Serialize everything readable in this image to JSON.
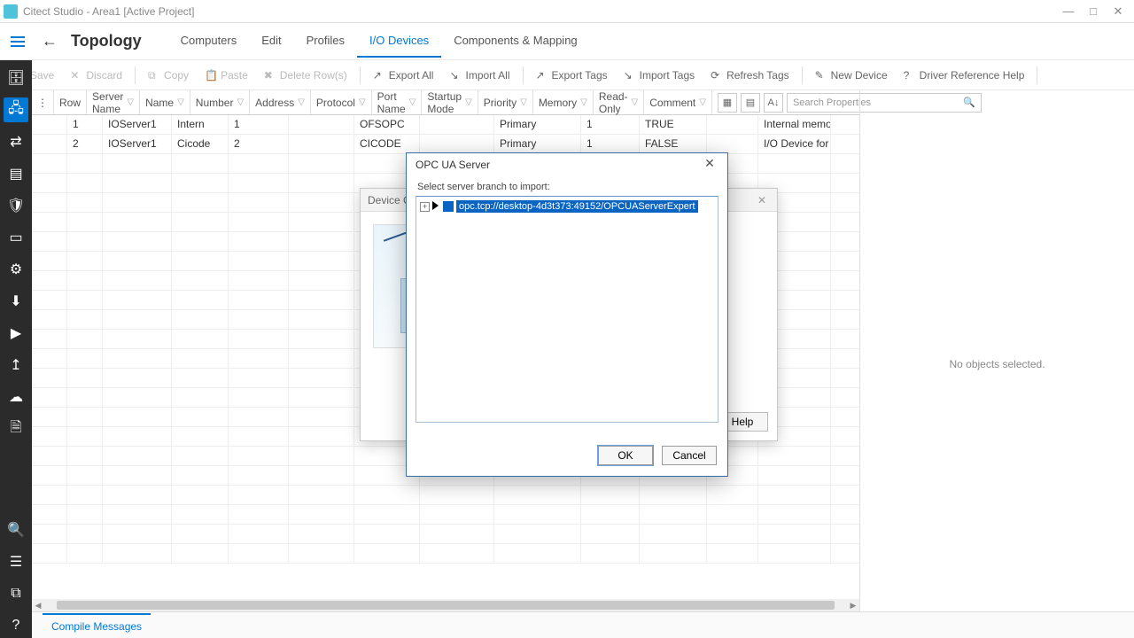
{
  "window": {
    "title": "Citect Studio - Area1 [Active Project]"
  },
  "section": "Topology",
  "tabs": [
    "Computers",
    "Edit",
    "Profiles",
    "I/O Devices",
    "Components & Mapping"
  ],
  "active_tab": "I/O Devices",
  "toolbar": {
    "save": "Save",
    "discard": "Discard",
    "copy": "Copy",
    "paste": "Paste",
    "deleterows": "Delete Row(s)",
    "exportall": "Export All",
    "importall": "Import All",
    "exporttags": "Export Tags",
    "importtags": "Import Tags",
    "refreshtags": "Refresh Tags",
    "newdevice": "New Device",
    "driverref": "Driver Reference Help"
  },
  "columns": [
    "Row",
    "Server Name",
    "Name",
    "Number",
    "Address",
    "Protocol",
    "Port Name",
    "Startup Mode",
    "Priority",
    "Memory",
    "Read-Only",
    "Comment"
  ],
  "rows": [
    {
      "row": "1",
      "server": "IOServer1",
      "name": "Intern",
      "num": "1",
      "addr": "",
      "proto": "OFSOPC",
      "port": "",
      "start": "Primary",
      "pri": "1",
      "mem": "TRUE",
      "ro": "",
      "comment": "Internal memory c"
    },
    {
      "row": "2",
      "server": "IOServer1",
      "name": "Cicode",
      "num": "2",
      "addr": "",
      "proto": "CICODE",
      "port": "",
      "start": "Primary",
      "pri": "1",
      "mem": "FALSE",
      "ro": "",
      "comment": "I/O Device for cal"
    }
  ],
  "search_placeholder": "Search Properties",
  "right_panel_message": "No objects selected.",
  "bottom_tab": "Compile Messages",
  "back_dialog": {
    "title": "Device Co",
    "help": "Help"
  },
  "front_dialog": {
    "title": "OPC UA Server",
    "label": "Select server branch to import:",
    "node": "opc.tcp://desktop-4d3t373:49152/OPCUAServerExpert",
    "ok": "OK",
    "cancel": "Cancel"
  }
}
